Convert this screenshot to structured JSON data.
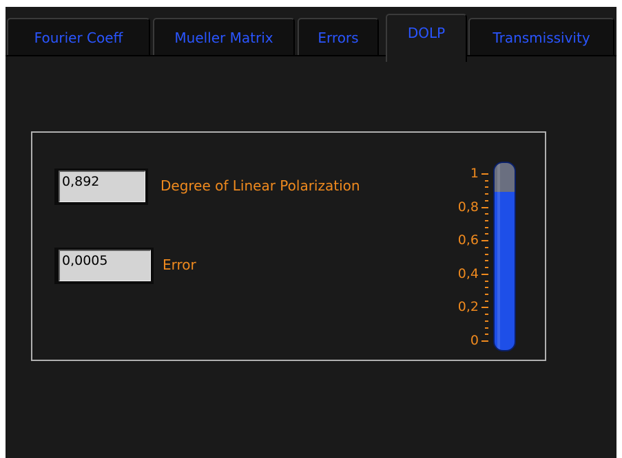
{
  "tabs": [
    {
      "label": "Fourier Coeff",
      "active": false
    },
    {
      "label": "Mueller Matrix",
      "active": false
    },
    {
      "label": "Errors",
      "active": false
    },
    {
      "label": "DOLP",
      "active": true
    },
    {
      "label": "Transmissivity",
      "active": false
    }
  ],
  "dolp": {
    "value": "0,892",
    "label": "Degree of Linear Polarization"
  },
  "error": {
    "value": "0,0005",
    "label": "Error"
  },
  "gauge": {
    "level": 0.892,
    "min": 0,
    "max": 1,
    "scale_labels": [
      "1",
      "0,8",
      "0,6",
      "0,4",
      "0,2",
      "0"
    ]
  },
  "colors": {
    "tab_text": "#2a55ff",
    "label_text": "#f08a1e",
    "gauge_fill": "#1e4fe8",
    "background": "#1a1a1a"
  }
}
